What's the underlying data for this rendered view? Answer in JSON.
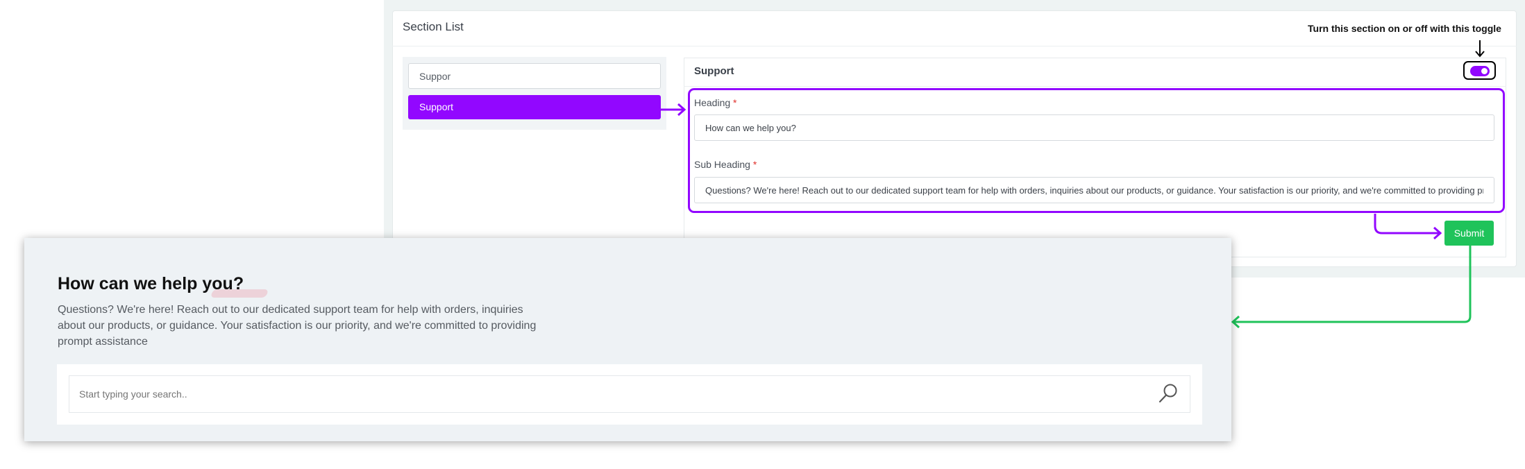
{
  "admin": {
    "section_title": "Section List",
    "list_search_value": "Suppor",
    "list_items": [
      {
        "label": "Support"
      }
    ],
    "form": {
      "title": "Support",
      "toggle_on": true,
      "heading_label": "Heading",
      "heading_value": "How can we help you?",
      "subheading_label": "Sub Heading",
      "subheading_value": "Questions? We're here! Reach out to our dedicated support team for help with orders, inquiries about our products, or guidance. Your satisfaction is our priority, and we're committed to providing prompt assistance",
      "required_mark": "*",
      "submit_label": "Submit"
    }
  },
  "annotation": {
    "toggle_note": "Turn this section on or off with this toggle"
  },
  "preview": {
    "heading": "How can we help you?",
    "subheading": "Questions? We're here! Reach out to our dedicated support team for help with orders, inquiries about our products, or guidance. Your satisfaction is our priority, and we're committed to providing prompt assistance",
    "search_placeholder": "Start typing your search.."
  },
  "colors": {
    "accent_purple": "#9207ff",
    "submit_green": "#1fc35a",
    "arrow_green": "#1fc35a"
  },
  "icons": {
    "search": "search-icon",
    "toggle": "toggle-switch"
  }
}
